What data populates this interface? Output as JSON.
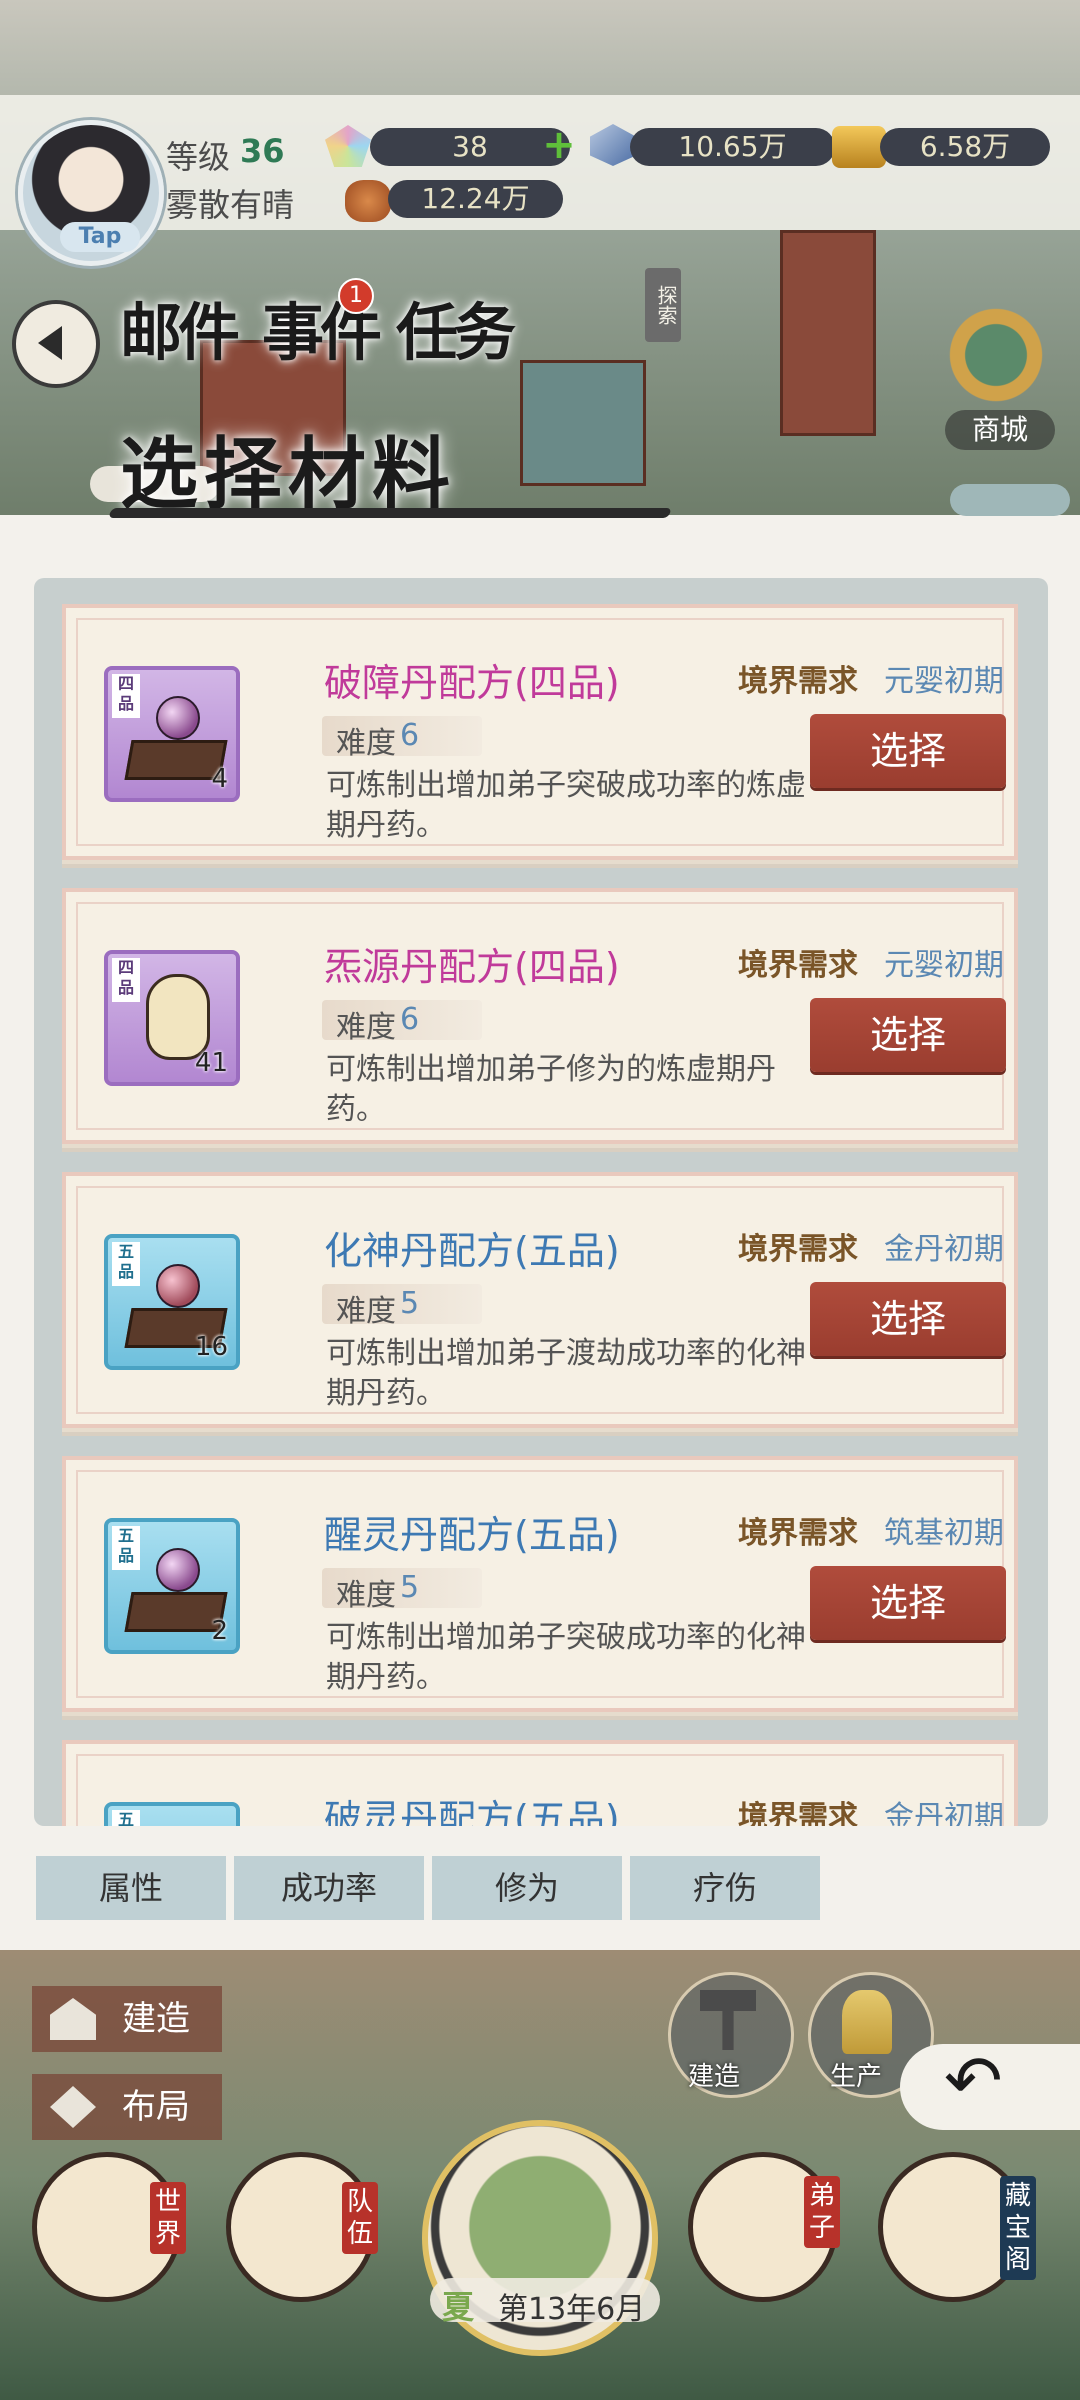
{
  "status": {
    "level_label": "等级",
    "level_value": "36",
    "weather": "雾散有晴",
    "tap_badge": "Tap",
    "resource1": "38",
    "resource2": "10.65万",
    "resource3": "6.58万",
    "resource4": "12.24万"
  },
  "nav": {
    "mail": "邮件",
    "event": "事件",
    "event_badge": "1",
    "task": "任务",
    "explore": "探索",
    "shop": "商城"
  },
  "panel": {
    "title": "选择材料",
    "requirement_label": "境界需求",
    "difficulty_label": "难度",
    "select_label": "选择"
  },
  "recipes": [
    {
      "name": "破障丹配方(四品)",
      "grade_tag": "四品",
      "grade_color": "purple",
      "count": "4",
      "difficulty": "6",
      "requirement": "元婴初期",
      "description": "可炼制出增加弟子突破成功率的炼虚期丹药。"
    },
    {
      "name": "炁源丹配方(四品)",
      "grade_tag": "四品",
      "grade_color": "purple",
      "count": "41",
      "difficulty": "6",
      "requirement": "元婴初期",
      "description": "可炼制出增加弟子修为的炼虚期丹药。"
    },
    {
      "name": "化神丹配方(五品)",
      "grade_tag": "五品",
      "grade_color": "blue",
      "count": "16",
      "difficulty": "5",
      "requirement": "金丹初期",
      "description": "可炼制出增加弟子渡劫成功率的化神期丹药。"
    },
    {
      "name": "醒灵丹配方(五品)",
      "grade_tag": "五品",
      "grade_color": "blue",
      "count": "2",
      "difficulty": "5",
      "requirement": "筑基初期",
      "description": "可炼制出增加弟子突破成功率的化神期丹药。"
    },
    {
      "name": "破灵丹配方(五品)",
      "grade_tag": "五品",
      "grade_color": "blue",
      "requirement": "金丹初期"
    }
  ],
  "tabs": [
    "属性",
    "成功率",
    "修为",
    "疗伤"
  ],
  "hud": {
    "build": "建造",
    "layout": "布局",
    "build_round": "建造",
    "production": "生产",
    "world": "世界",
    "team": "队伍",
    "disciple": "弟子",
    "treasure": "藏宝阁",
    "season": "夏",
    "date": "第13年6月"
  },
  "colors": {
    "panel_bg": "#f3f1ec",
    "select_button": "#a8463a",
    "grade4": "#c03a9a",
    "grade5": "#3d79b3",
    "requirement_value": "#5b88b3"
  }
}
